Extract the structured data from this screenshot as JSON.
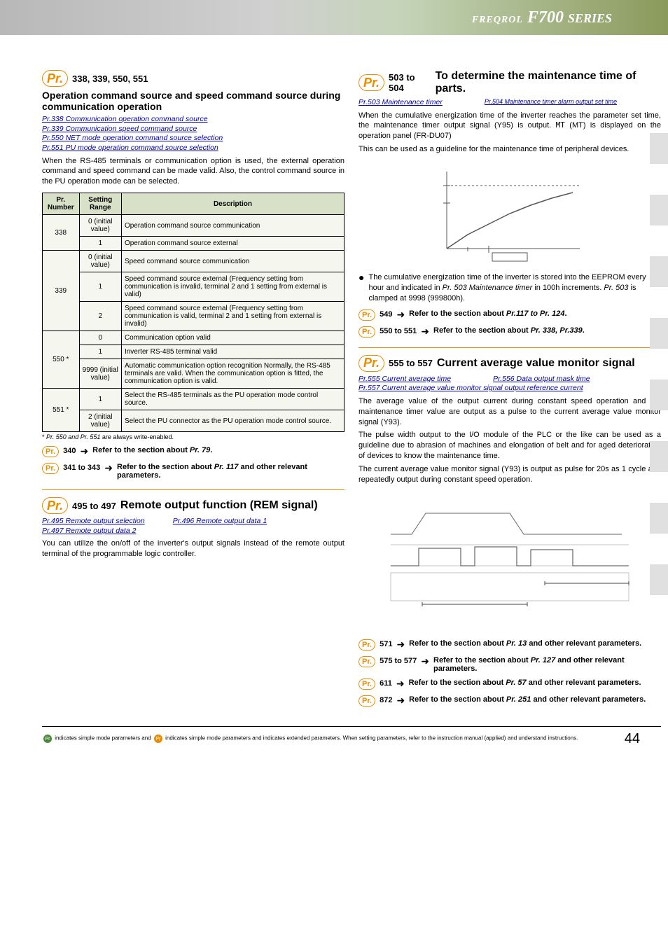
{
  "header": {
    "logo": "F700",
    "logo_prefix": "FREQROL",
    "series": "SERIES"
  },
  "left": {
    "sec1": {
      "pr": "Pr.",
      "range": "338, 339, 550, 551",
      "subtitle": "Operation command source and speed command source during communication operation",
      "links": [
        "Pr.338 Communication operation command source",
        "Pr.339 Communication speed command source",
        "Pr.550 NET mode operation command source selection",
        "Pr.551 PU mode operation command source selection"
      ],
      "body": "When the RS-485 terminals or communication option is used, the external operation command and speed command can be made valid. Also, the control command source in the PU operation mode can be selected.",
      "table": {
        "headers": [
          "Pr. Number",
          "Setting Range",
          "Description"
        ],
        "rows": [
          {
            "num": "338",
            "rowspan_num": 2,
            "range": "0 (initial value)",
            "desc": "Operation command source communication"
          },
          {
            "num": "",
            "range": "1",
            "desc": "Operation command source external"
          },
          {
            "num": "339",
            "rowspan_num": 3,
            "range": "0 (initial value)",
            "desc": "Speed command source communication"
          },
          {
            "num": "",
            "range": "1",
            "desc": "Speed command source external (Frequency setting from communication is invalid, terminal 2 and 1 setting from external is valid)"
          },
          {
            "num": "",
            "range": "2",
            "desc": "Speed command source external (Frequency setting from communication is valid, terminal 2 and 1 setting from external is invalid)"
          },
          {
            "num": "550 *",
            "rowspan_num": 3,
            "range": "0",
            "desc": "Communication option valid"
          },
          {
            "num": "",
            "range": "1",
            "desc": "Inverter RS-485 terminal valid"
          },
          {
            "num": "",
            "range": "9999 (initial value)",
            "desc": "Automatic communication option recognition Normally, the RS-485 terminals are valid. When the communication option is fitted, the communication option is valid."
          },
          {
            "num": "551 *",
            "rowspan_num": 2,
            "range": "1",
            "desc": "Select the RS-485 terminals as the PU operation mode control source."
          },
          {
            "num": "",
            "range": "2 (initial value)",
            "desc": "Select the PU connector as the PU operation mode control source."
          }
        ]
      },
      "footnote_star": "*",
      "footnote": "Pr. 550 and Pr. 551",
      "footnote_suffix": " are always write-enabled.",
      "ref1": {
        "pr": "Pr.",
        "num": "340",
        "text": "Refer to the section about ",
        "it": "Pr. 79",
        "suffix": "."
      },
      "ref2": {
        "pr": "Pr.",
        "num": "341 to 343",
        "text": "Refer to the section about ",
        "it": "Pr. 117",
        "suffix": " and other relevant parameters."
      }
    },
    "sec2": {
      "pr": "Pr.",
      "range": "495 to 497",
      "title": "Remote output function (REM signal)",
      "links": [
        "Pr.495 Remote output selection",
        "Pr.496 Remote output data 1",
        "Pr.497 Remote output data 2"
      ],
      "body": "You can utilize the on/off of the inverter's output signals instead of the remote output terminal of the programmable logic controller."
    }
  },
  "right": {
    "sec1": {
      "pr": "Pr.",
      "range": "503 to 504",
      "title": "To determine the maintenance time of parts.",
      "link1": "Pr.503 Maintenance timer",
      "link2": "Pr.504 Maintenance timer alarm output set time",
      "body1": "When the cumulative energization time of the inverter reaches the parameter set time, the maintenance timer output signal (Y95) is output.  ",
      "mt": "MT",
      "body1b": " (MT) is displayed on the operation panel (FR-DU07)",
      "body2": "This can be used as a guideline for the maintenance time of peripheral devices.",
      "bullet": "The cumulative energization time of the inverter is stored into the EEPROM every hour and indicated in ",
      "bullet_it": "Pr. 503 Maintenance timer",
      "bullet2": " in 100h increments. ",
      "bullet2_it": "Pr. 503",
      "bullet3": " is clamped at 9998 (999800h).",
      "ref1": {
        "pr": "Pr.",
        "num": "549",
        "text": "Refer to the section about ",
        "it": "Pr.117 to Pr. 124",
        "suffix": "."
      },
      "ref2": {
        "pr": "Pr.",
        "num": "550 to 551",
        "text": "Refer to the section about ",
        "it": "Pr. 338, Pr.339",
        "suffix": "."
      }
    },
    "sec2": {
      "pr": "Pr.",
      "range": "555 to 557",
      "title": "Current average value monitor signal",
      "link1": "Pr.555 Current average time",
      "link2": "Pr.556 Data output mask time",
      "link3": "Pr.557 Current average value monitor signal output reference current",
      "body1": "The average value of the output current during constant speed operation and the maintenance timer value are output as a pulse to the current average value monitor signal (Y93).",
      "body2": "The pulse width output to the I/O module of the PLC or the like can be used as a guideline due to abrasion of machines and elongation of belt and for aged deterioration of devices to know the maintenance time.",
      "body3": "The current average value monitor signal (Y93) is output as pulse for 20s as 1 cycle and repeatedly output during constant speed operation.",
      "refs": [
        {
          "pr": "Pr.",
          "num": "571",
          "text": "Refer to the section about ",
          "it": "Pr. 13",
          "suffix": " and other relevant parameters."
        },
        {
          "pr": "Pr.",
          "num": "575 to 577",
          "text": "Refer to the section about ",
          "it": "Pr. 127",
          "suffix": " and other relevant parameters."
        },
        {
          "pr": "Pr.",
          "num": "611",
          "text": "Refer to the section about ",
          "it": "Pr. 57",
          "suffix": " and other relevant parameters."
        },
        {
          "pr": "Pr.",
          "num": "872",
          "text": "Refer to the section about ",
          "it": "Pr. 251",
          "suffix": " and other relevant parameters."
        }
      ]
    }
  },
  "footer": {
    "text": " indicates simple mode parameters and  indicates extended parameters. When setting parameters, refer to the instruction manual (applied) and understand instructions.",
    "prefix": "",
    "page": "44"
  }
}
